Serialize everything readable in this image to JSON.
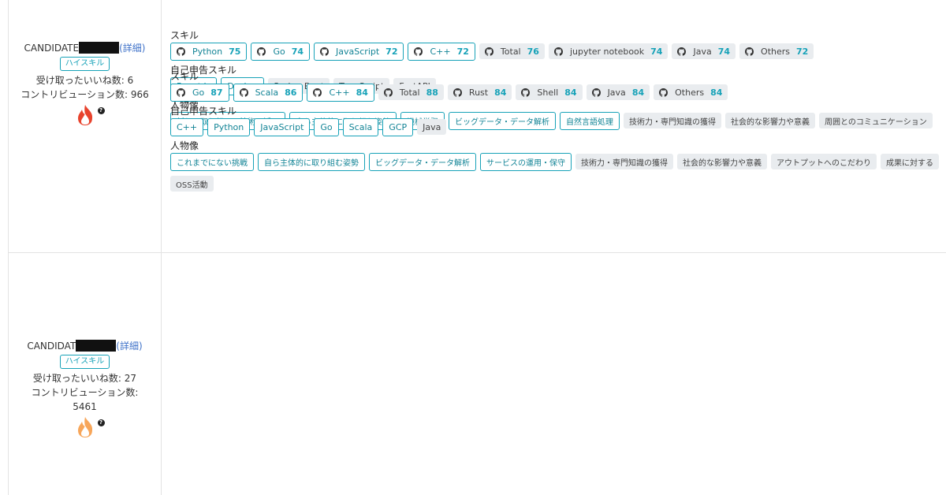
{
  "candidates": [
    {
      "id_prefix": "CANDIDATE",
      "detail_label": "(詳細)",
      "badge": "ハイスキル",
      "likes_line": "受け取ったいいね数: 6",
      "contrib_line": "コントリビューション数: 966",
      "contrib_value": "",
      "skills_heading": "スキル",
      "skills": [
        {
          "name": "Python",
          "score": "75",
          "style": "outline"
        },
        {
          "name": "Go",
          "score": "74",
          "style": "outline"
        },
        {
          "name": "JavaScript",
          "score": "72",
          "style": "outline"
        },
        {
          "name": "C++",
          "score": "72",
          "style": "outline"
        },
        {
          "name": "Total",
          "score": "76",
          "style": "gray"
        },
        {
          "name": "jupyter notebook",
          "score": "74",
          "style": "gray"
        },
        {
          "name": "Java",
          "score": "74",
          "style": "gray"
        },
        {
          "name": "Others",
          "score": "72",
          "style": "gray"
        }
      ],
      "self_heading": "自己申告スキル",
      "self_skills": [
        {
          "name": "React.js",
          "style": "outline"
        },
        {
          "name": "Docker",
          "style": "outline"
        },
        {
          "name": "Spring Boot",
          "style": "gray"
        },
        {
          "name": "TypeScript",
          "style": "gray"
        },
        {
          "name": "FastAPI",
          "style": "gray"
        }
      ],
      "persona_heading": "人物像",
      "persona": [
        {
          "name": "新しい取り組み・技術の活用",
          "style": "outline"
        },
        {
          "name": "自ら主体的に取り組む姿勢",
          "style": "outline"
        },
        {
          "name": "機械学習",
          "style": "outline"
        },
        {
          "name": "ビッグデータ・データ解析",
          "style": "outline"
        },
        {
          "name": "自然言語処理",
          "style": "outline"
        },
        {
          "name": "技術力・専門知識の獲得",
          "style": "gray"
        },
        {
          "name": "社会的な影響力や意義",
          "style": "gray"
        },
        {
          "name": "周囲とのコミュニケーション",
          "style": "gray"
        }
      ],
      "persona2": []
    },
    {
      "id_prefix": "CANDIDAT",
      "detail_label": "(詳細)",
      "badge": "ハイスキル",
      "likes_line": "受け取ったいいね数: 27",
      "contrib_line": "コントリビューション数:",
      "contrib_value": "5461",
      "skills_heading": "スキル",
      "skills": [
        {
          "name": "Go",
          "score": "87",
          "style": "outline"
        },
        {
          "name": "Scala",
          "score": "86",
          "style": "outline"
        },
        {
          "name": "C++",
          "score": "84",
          "style": "outline"
        },
        {
          "name": "Total",
          "score": "88",
          "style": "gray"
        },
        {
          "name": "Rust",
          "score": "84",
          "style": "gray"
        },
        {
          "name": "Shell",
          "score": "84",
          "style": "gray"
        },
        {
          "name": "Java",
          "score": "84",
          "style": "gray"
        },
        {
          "name": "Others",
          "score": "84",
          "style": "gray"
        }
      ],
      "self_heading": "自己申告スキル",
      "self_skills": [
        {
          "name": "C++",
          "style": "outline"
        },
        {
          "name": "Python",
          "style": "outline"
        },
        {
          "name": "JavaScript",
          "style": "outline"
        },
        {
          "name": "Go",
          "style": "outline"
        },
        {
          "name": "Scala",
          "style": "outline"
        },
        {
          "name": "GCP",
          "style": "outline"
        },
        {
          "name": "Java",
          "style": "gray"
        }
      ],
      "persona_heading": "人物像",
      "persona": [
        {
          "name": "これまでにない挑戦",
          "style": "outline"
        },
        {
          "name": "自ら主体的に取り組む姿勢",
          "style": "outline"
        },
        {
          "name": "ビッグデータ・データ解析",
          "style": "outline"
        },
        {
          "name": "サービスの運用・保守",
          "style": "outline"
        },
        {
          "name": "技術力・専門知識の獲得",
          "style": "gray"
        },
        {
          "name": "社会的な影響力や意義",
          "style": "gray"
        },
        {
          "name": "アウトプットへのこだわり",
          "style": "gray"
        },
        {
          "name": "成果に対する",
          "style": "gray"
        }
      ],
      "persona2": [
        {
          "name": "OSS活動",
          "style": "gray"
        }
      ]
    }
  ],
  "colors": {
    "accent": "#17a2b8",
    "link": "#3f72c9",
    "tag_gray": "#e9ecef",
    "fire_outer": "#e8432d",
    "fire_inner": "#f7a65a"
  },
  "icons": {
    "skill": "github-icon",
    "popularity": "fire-icon",
    "help": "question-icon"
  }
}
